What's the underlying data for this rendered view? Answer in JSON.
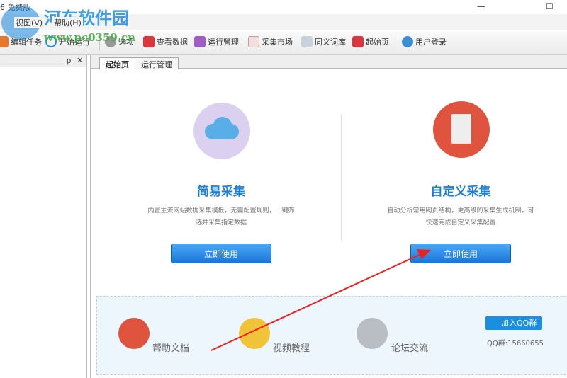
{
  "window": {
    "title": "6 免费版",
    "minimize": "—",
    "maximize": "☐"
  },
  "watermark": {
    "name": "河东软件园",
    "url": "www.pc0359.cn"
  },
  "menu": [
    {
      "label": "视图(V)"
    },
    {
      "label": "帮助(H)"
    }
  ],
  "toolbar": [
    {
      "label": "编辑任务",
      "color": "#e8772e"
    },
    {
      "label": "开始运行",
      "color": "#2d8fe0"
    },
    {
      "label": "选项",
      "color": "#888888"
    },
    {
      "label": "查看数据",
      "color": "#d9363e"
    },
    {
      "label": "运行管理",
      "color": "#a05cc7"
    },
    {
      "label": "采集市场",
      "color": "#d88"
    },
    {
      "label": "同义词库",
      "color": "#9aa7b5"
    },
    {
      "label": "起始页",
      "color": "#d9363e"
    },
    {
      "label": "用户登录",
      "color": "#3a8fd8"
    }
  ],
  "left_panel": {
    "pin": "📌",
    "close": "✕"
  },
  "tabs": [
    {
      "label": "起始页"
    },
    {
      "label": "运行管理"
    }
  ],
  "cards": [
    {
      "title": "简易采集",
      "desc1": "内置主流网站数据采集模板，无需配置规则，一键筛",
      "desc2": "选并采集指定数据",
      "button": "立即使用",
      "color": "#dcd0f0"
    },
    {
      "title": "自定义采集",
      "desc1": "自动分析常用网页结构，更高级的采集生成机制，可",
      "desc2": "快速完成自定义采集配置",
      "button": "立即使用",
      "color": "#e0533f"
    }
  ],
  "links": [
    {
      "label": "帮助文档",
      "color": "#e0533f"
    },
    {
      "label": "视频教程",
      "color": "#f0c338"
    },
    {
      "label": "论坛交流",
      "color": "#b9bec5"
    }
  ],
  "qq": {
    "button": "加入QQ群",
    "number": "QQ群:15660655"
  }
}
